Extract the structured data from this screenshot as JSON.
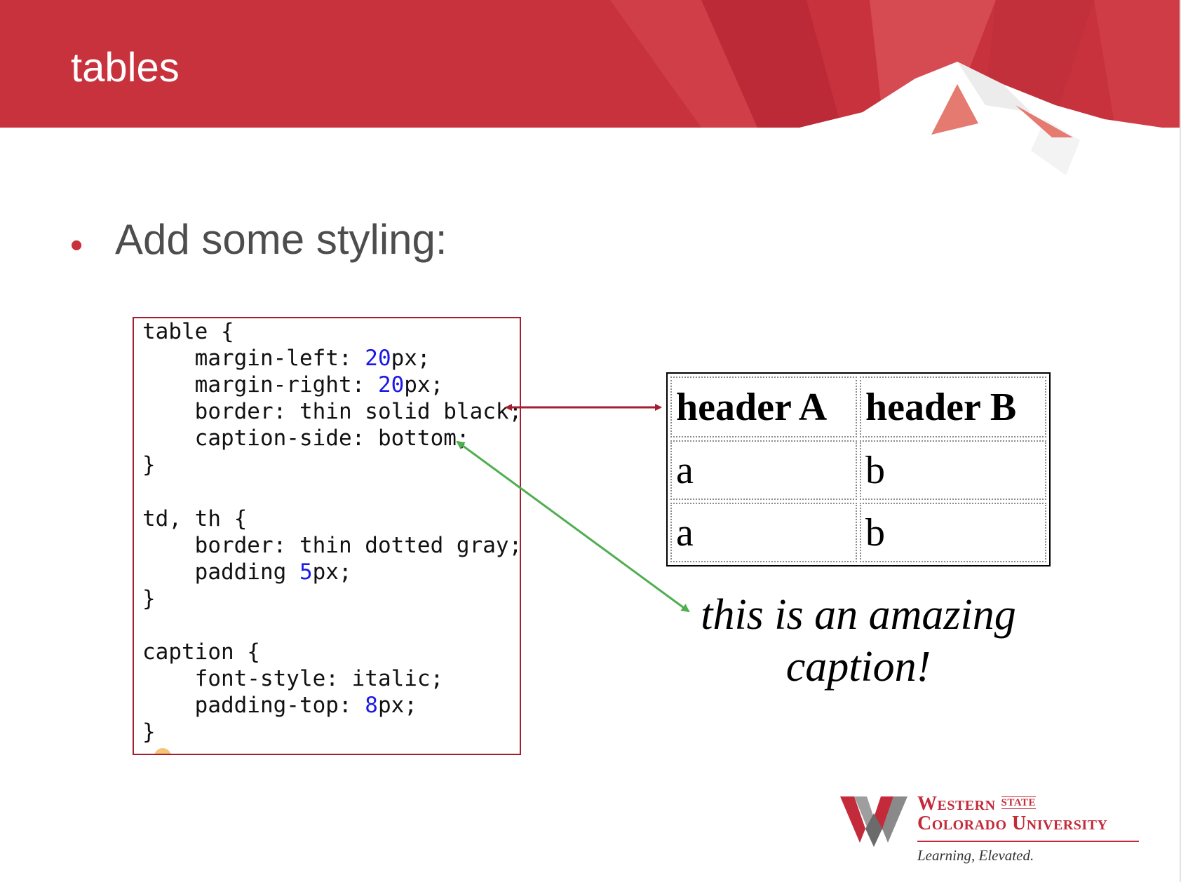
{
  "slide": {
    "title": "tables",
    "bullet": "Add some styling:"
  },
  "code": {
    "lines": [
      [
        {
          "t": "table {"
        }
      ],
      [
        {
          "t": "    margin-left: "
        },
        {
          "t": "20",
          "num": true
        },
        {
          "t": "px;"
        }
      ],
      [
        {
          "t": "    margin-right: "
        },
        {
          "t": "20",
          "num": true
        },
        {
          "t": "px;"
        }
      ],
      [
        {
          "t": "    border: thin solid black;"
        }
      ],
      [
        {
          "t": "    caption-side: bottom;"
        }
      ],
      [
        {
          "t": "}"
        }
      ],
      [
        {
          "t": ""
        }
      ],
      [
        {
          "t": "td, th {"
        }
      ],
      [
        {
          "t": "    border: thin dotted gray;"
        }
      ],
      [
        {
          "t": "    padding "
        },
        {
          "t": "5",
          "num": true
        },
        {
          "t": "px;"
        }
      ],
      [
        {
          "t": "}"
        }
      ],
      [
        {
          "t": ""
        }
      ],
      [
        {
          "t": "caption {"
        }
      ],
      [
        {
          "t": "    font-style: italic;"
        }
      ],
      [
        {
          "t": "    padding-top: "
        },
        {
          "t": "8",
          "num": true
        },
        {
          "t": "px;"
        }
      ],
      [
        {
          "t": "}"
        }
      ]
    ]
  },
  "example_table": {
    "headers": [
      "header A",
      "header B"
    ],
    "rows": [
      [
        "a",
        "b"
      ],
      [
        "a",
        "b"
      ]
    ],
    "caption": "this is an amazing caption!"
  },
  "logo": {
    "line1": "Western",
    "state": "STATE",
    "line2": "Colorado University",
    "tagline": "Learning, Elevated."
  },
  "colors": {
    "banner_red": "#c8323d",
    "arrow_red": "#a31e2e",
    "arrow_green": "#4fae4f",
    "bullet_red": "#c8323d",
    "number_blue": "#1a1ae6"
  }
}
